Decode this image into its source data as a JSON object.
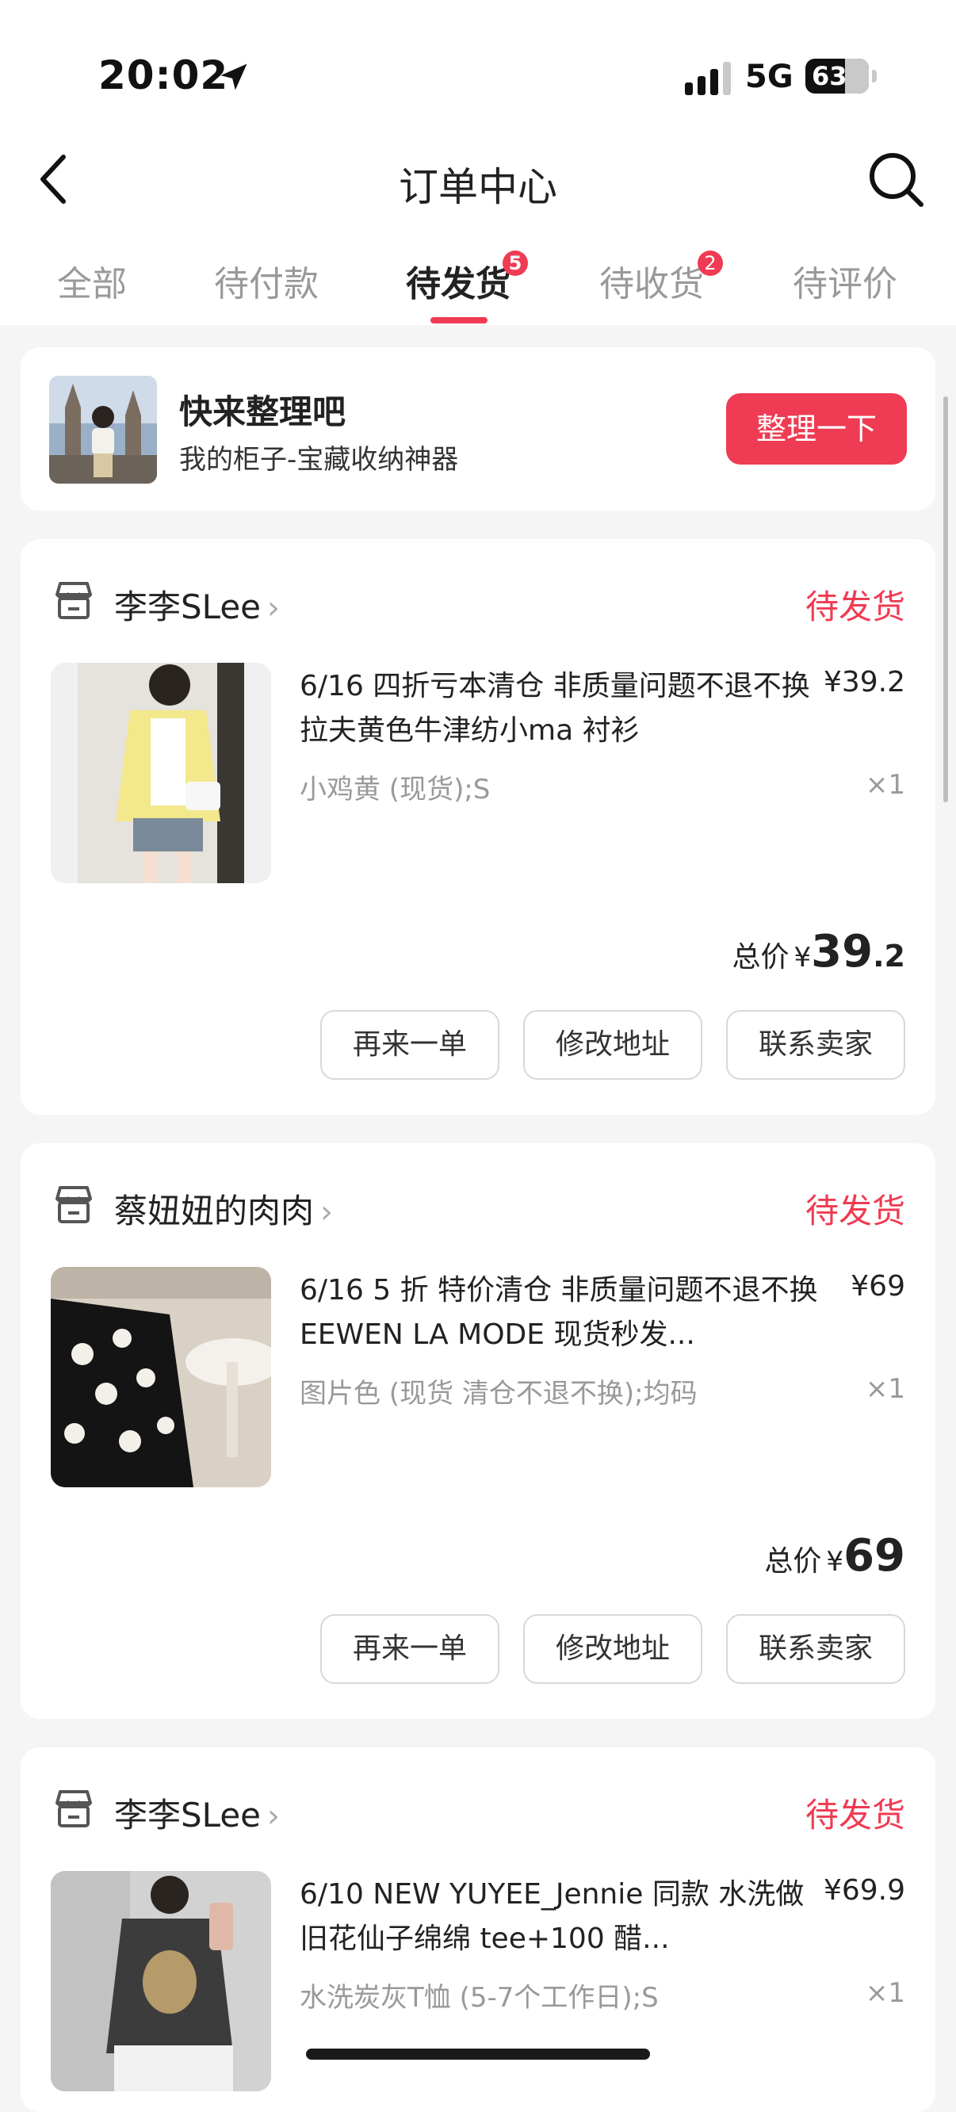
{
  "status_bar": {
    "time": "20:02",
    "network": "5G",
    "battery": "63"
  },
  "header": {
    "title": "订单中心"
  },
  "tabs": [
    {
      "label": "全部",
      "badge": ""
    },
    {
      "label": "待付款",
      "badge": ""
    },
    {
      "label": "待发货",
      "badge": "5"
    },
    {
      "label": "待收货",
      "badge": "2"
    },
    {
      "label": "待评价",
      "badge": ""
    }
  ],
  "promo": {
    "title": "快来整理吧",
    "subtitle": "我的柜子-宝藏收纳神器",
    "button": "整理一下"
  },
  "orders": [
    {
      "shop": "李李SLee",
      "status": "待发货",
      "title": "6/16 四折亏本清仓 非质量问题不退不换 拉夫黄色牛津纺小ma 衬衫",
      "price": "¥39.2",
      "spec": "小鸡黄 (现货);S",
      "qty": "×1",
      "total_label": "总价",
      "currency": "¥",
      "total_int": "39",
      "total_dec": ".2",
      "buttons": [
        "再来一单",
        "修改地址",
        "联系卖家"
      ]
    },
    {
      "shop": "蔡妞妞的肉肉",
      "status": "待发货",
      "title": "6/16 5 折 特价清仓 非质量问题不退不换  EEWEN LA MODE 现货秒发...",
      "price": "¥69",
      "spec": "图片色 (现货 清仓不退不换);均码",
      "qty": "×1",
      "total_label": "总价",
      "currency": "¥",
      "total_int": "69",
      "total_dec": "",
      "buttons": [
        "再来一单",
        "修改地址",
        "联系卖家"
      ]
    },
    {
      "shop": "李李SLee",
      "status": "待发货",
      "title": "6/10 NEW YUYEE_Jennie 同款 水洗做旧花仙子绵绵 tee+100 醋...",
      "price": "¥69.9",
      "spec": "水洗炭灰T恤 (5-7个工作日);S",
      "qty": "×1"
    }
  ]
}
